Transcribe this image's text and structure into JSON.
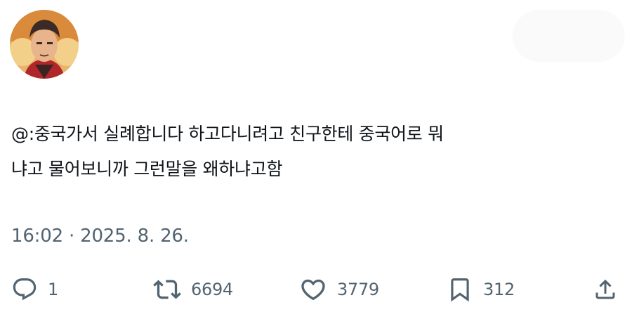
{
  "tweet": {
    "lines": [
      "@:중국가서 실례합니다 하고다니려고 친구한테 중국어로 뭐",
      "냐고 물어보니까 그런말을 왜하냐고함"
    ],
    "timestamp": "16:02 · 2025. 8. 26."
  },
  "actions": {
    "reply": {
      "icon": "reply-icon",
      "count": "1"
    },
    "retweet": {
      "icon": "retweet-icon",
      "count": "6694"
    },
    "like": {
      "icon": "heart-icon",
      "count": "3779"
    },
    "bookmark": {
      "icon": "bookmark-icon",
      "count": "312"
    },
    "share": {
      "icon": "share-icon"
    }
  },
  "colors": {
    "text": "#0f1419",
    "muted": "#536471",
    "background": "#ffffff"
  }
}
